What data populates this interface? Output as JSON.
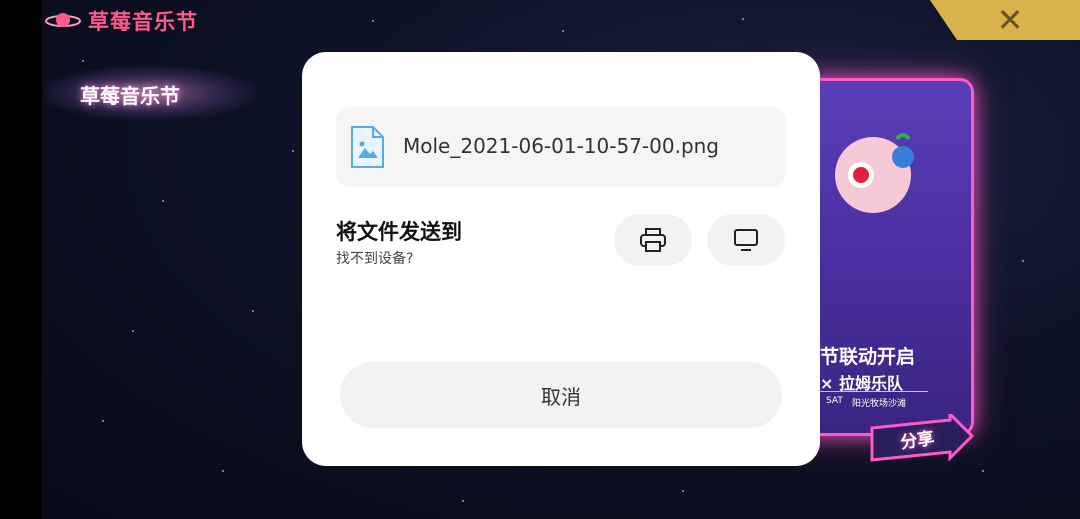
{
  "game": {
    "logo_text": "草莓音乐节",
    "banner_text": "草莓音乐节",
    "close_symbol": "✕",
    "poster": {
      "title": "节联动开启",
      "subtitle": "× 拉姆乐队",
      "date": "SAT",
      "venue": "阳光牧场沙滩",
      "share_label": "分享"
    }
  },
  "dialog": {
    "file": {
      "name": "Mole_2021-06-01-10-57-00.png",
      "icon": "image-file-icon"
    },
    "send_title": "将文件发送到",
    "send_subtitle": "找不到设备?",
    "targets": [
      {
        "icon": "printer-icon"
      },
      {
        "icon": "monitor-icon"
      }
    ],
    "cancel_label": "取消"
  },
  "colors": {
    "accent_pink": "#ff5a8a",
    "gold": "#d8b24a",
    "dialog_bg": "#ffffff",
    "button_bg": "#f2f2f3",
    "file_icon_blue": "#5aa9e6"
  }
}
